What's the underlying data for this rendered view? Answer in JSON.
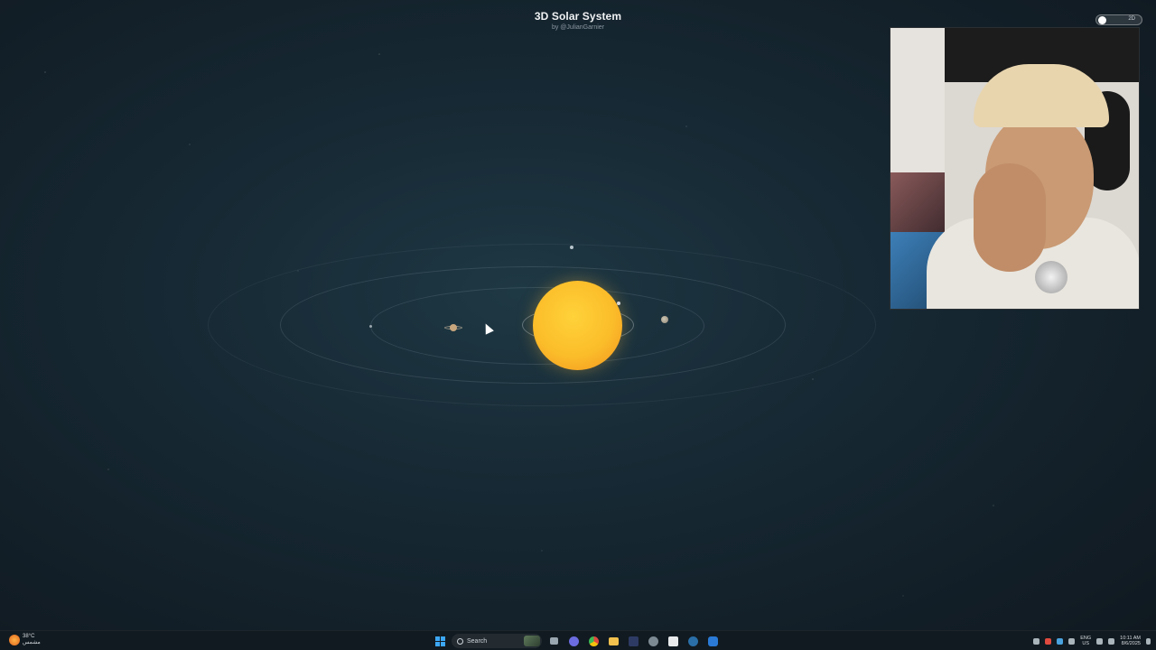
{
  "app": {
    "title": "3D Solar System",
    "byline": "by @JulianGarnier",
    "view_toggle_label": "2D"
  },
  "scene": {
    "sun_color": "#fbbd2a",
    "background_color": "#172a35"
  },
  "taskbar": {
    "weather_temp": "38°C",
    "weather_desc": "مشمس",
    "search_label": "Search",
    "language_line1": "ENG",
    "language_line2": "US",
    "time": "10:11 AM",
    "date": "8/6/2025",
    "accent_color": "#3ca7f5"
  }
}
